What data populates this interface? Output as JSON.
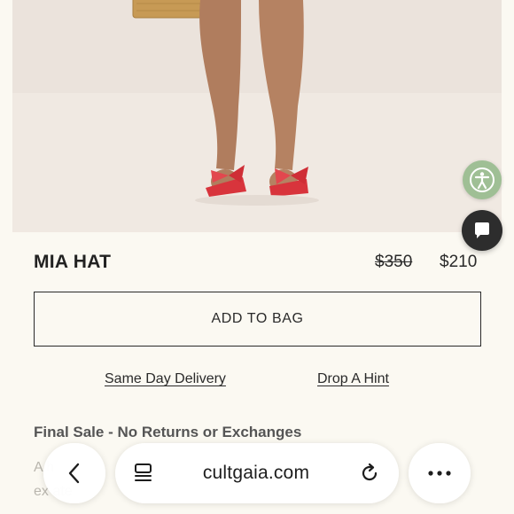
{
  "product": {
    "name": "MIA HAT",
    "price_original": "$350",
    "price_sale": "$210",
    "add_to_bag_label": "ADD TO BAG",
    "links": {
      "same_day_delivery": "Same Day Delivery",
      "drop_a_hint": "Drop A Hint"
    },
    "final_sale_notice": "Final Sale - No Returns or Exchanges",
    "description_partial": {
      "line1": "A      h",
      "line2": "ex      ate"
    },
    "image_alt": "Model wearing red bow slide sandals holding a woven basket bag"
  },
  "widgets": {
    "accessibility_icon": "accessibility-icon",
    "chat_icon": "chat-bubble-icon"
  },
  "browser": {
    "url": "cultgaia.com",
    "back_icon": "chevron-left-icon",
    "tabs_icon": "tabs-icon",
    "reload_icon": "reload-icon",
    "more_icon": "more-dots-icon"
  },
  "colors": {
    "background": "#fbf9f2",
    "text": "#2a2a2a",
    "accessibility_bg": "#9fbf95",
    "chat_bg": "#2d2d2d",
    "sandal": "#d8343c"
  }
}
